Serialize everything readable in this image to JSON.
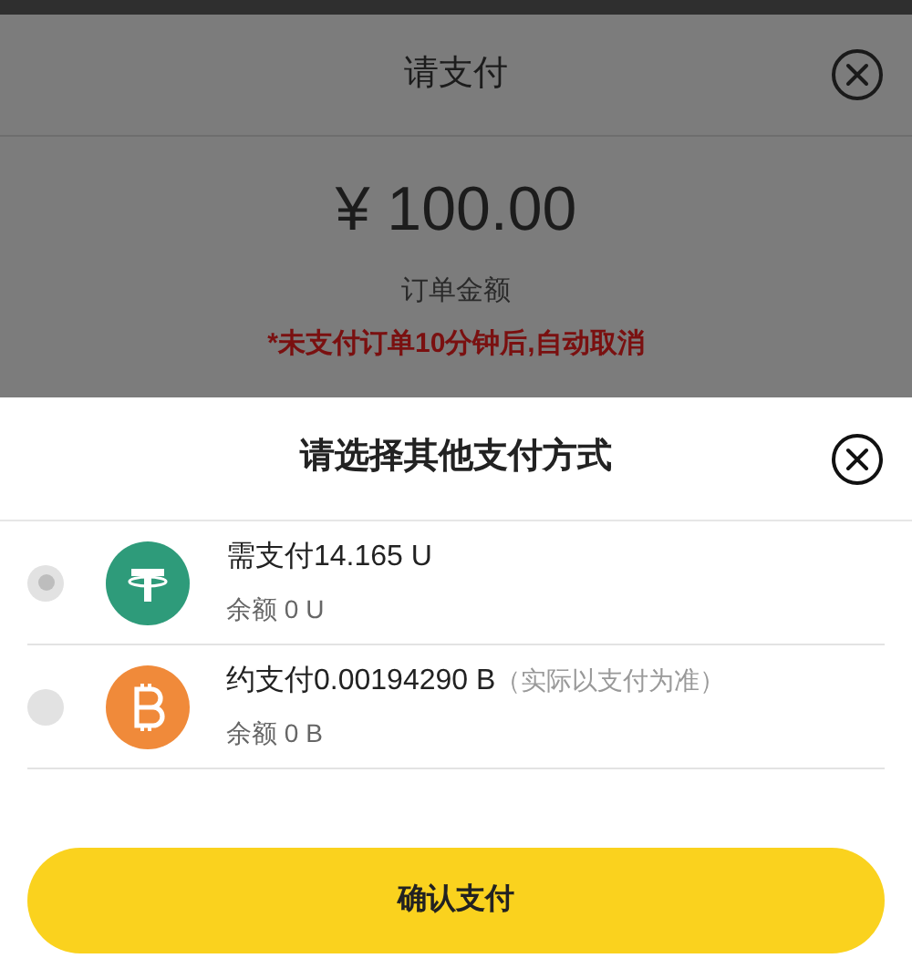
{
  "pay_sheet": {
    "title": "请支付",
    "amount": "¥ 100.00",
    "amount_label": "订单金额",
    "warning": "*未支付订单10分钟后,自动取消"
  },
  "method_sheet": {
    "title": "请选择其他支付方式",
    "methods": [
      {
        "kind": "tether",
        "amount": "需支付14.165 U",
        "balance": "余额 0 U",
        "selected": true
      },
      {
        "kind": "bitcoin",
        "amount": "约支付0.00194290 B",
        "note": "（实际以支付为准）",
        "balance": "余额 0 B",
        "selected": false
      }
    ],
    "confirm": "确认支付"
  }
}
